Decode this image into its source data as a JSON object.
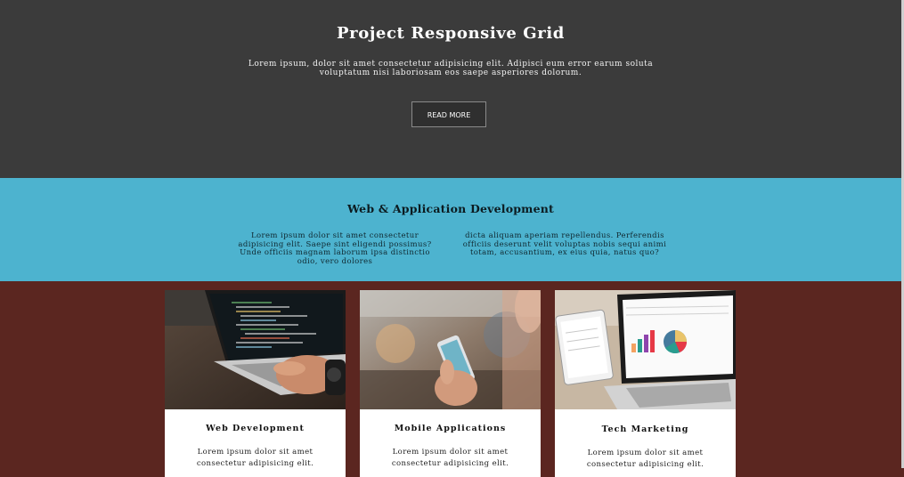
{
  "hero": {
    "title": "Project Responsive Grid",
    "text": "Lorem ipsum, dolor sit amet consectetur adipisicing elit. Adipisci eum error earum soluta voluptatum nisi laboriosam eos saepe asperiores dolorum.",
    "button_label": "READ MORE"
  },
  "band": {
    "title": "Web & Application Development",
    "col1": "Lorem ipsum dolor sit amet consectetur adipisicing elit. Saepe sint eligendi possimus? Unde officiis magnam laborum ipsa distinctio odio, vero dolores",
    "col2": "dicta aliquam aperiam repellendus. Perferendis officiis deserunt velit voluptas nobis sequi animi totam, accusantium, ex eius quia, natus quo?"
  },
  "cards": [
    {
      "title": "Web Development",
      "text": "Lorem ipsum dolor sit amet consectetur adipisicing elit."
    },
    {
      "title": "Mobile Applications",
      "text": "Lorem ipsum dolor sit amet consectetur adipisicing elit."
    },
    {
      "title": "Tech Marketing",
      "text": "Lorem ipsum dolor sit amet consectetur adipisicing elit."
    }
  ],
  "colors": {
    "hero_bg": "#3b3b3b",
    "band_bg": "#4db3cf",
    "page_bg": "#5b2620"
  }
}
